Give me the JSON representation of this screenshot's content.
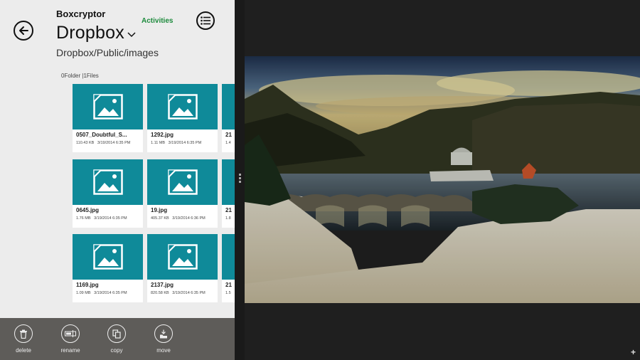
{
  "header": {
    "app_name": "Boxcryptor",
    "service": "Dropbox",
    "activities": "Activities",
    "path": "Dropbox/Public/images"
  },
  "counts": {
    "folders": "0Folder",
    "files": "|1Files"
  },
  "files": [
    {
      "name": "0507_Doubtful_S...",
      "size": "110.43 KB",
      "date": "3/19/2014 6:35 PM"
    },
    {
      "name": "1292.jpg",
      "size": "1.11 MB",
      "date": "3/19/2014 6:35 PM"
    },
    {
      "name": "21",
      "size": "1.4",
      "date": ""
    },
    {
      "name": "0645.jpg",
      "size": "1.76 MB",
      "date": "3/19/2014 6:35 PM"
    },
    {
      "name": "19.jpg",
      "size": "405.37 KB",
      "date": "3/19/2014 6:36 PM"
    },
    {
      "name": "21",
      "size": "1.8",
      "date": ""
    },
    {
      "name": "1169.jpg",
      "size": "1.09 MB",
      "date": "3/19/2014 6:35 PM"
    },
    {
      "name": "2137.jpg",
      "size": "820.58 KB",
      "date": "3/19/2014 6:35 PM"
    },
    {
      "name": "21",
      "size": "1.5",
      "date": ""
    }
  ],
  "appbar": {
    "delete": "delete",
    "rename": "rename",
    "copy": "copy",
    "move": "move"
  },
  "colors": {
    "tile_accent": "#0f8a99",
    "activities": "#1c8a3c",
    "appbar": "#5e5c59"
  },
  "icons": [
    "back-arrow-icon",
    "chevron-down-icon",
    "list-menu-icon",
    "image-file-icon",
    "trash-icon",
    "rename-icon",
    "copy-icon",
    "move-icon",
    "plus-icon"
  ]
}
